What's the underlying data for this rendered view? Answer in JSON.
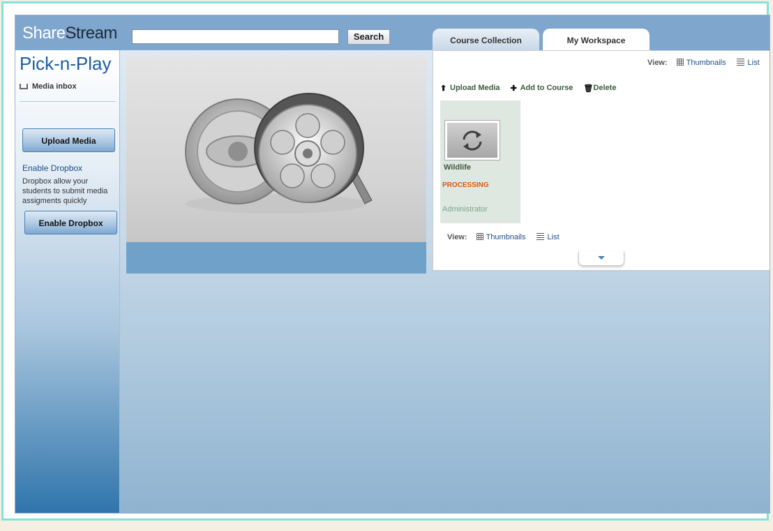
{
  "header": {
    "logo_part1": "Share",
    "logo_part2": "Stream",
    "search_value": "",
    "search_button": "Search"
  },
  "tabs": [
    {
      "label": "Course Collection",
      "active": false
    },
    {
      "label": "My Workspace",
      "active": true
    }
  ],
  "sidebar": {
    "title": "Pick-n-Play",
    "inbox_label": "Media inbox",
    "upload_button": "Upload Media",
    "enable_dropbox_link": "Enable Dropbox",
    "dropbox_description": "Dropbox allow your students to submit media assigments quickly",
    "enable_dropbox_button": "Enable Dropbox"
  },
  "workspace": {
    "view_label": "View:",
    "view_thumbnails": "Thumbnails",
    "view_list": "List",
    "actions": {
      "upload": "Upload Media",
      "add_to_course": "Add to Course",
      "delete": "Delete"
    },
    "media_items": [
      {
        "title": "Wildlife",
        "status": "PROCESSING",
        "owner": "Administrator"
      }
    ]
  },
  "colors": {
    "header_bg": "#7fa6cc",
    "processing": "#d35a0c",
    "link": "#1d4e86"
  }
}
